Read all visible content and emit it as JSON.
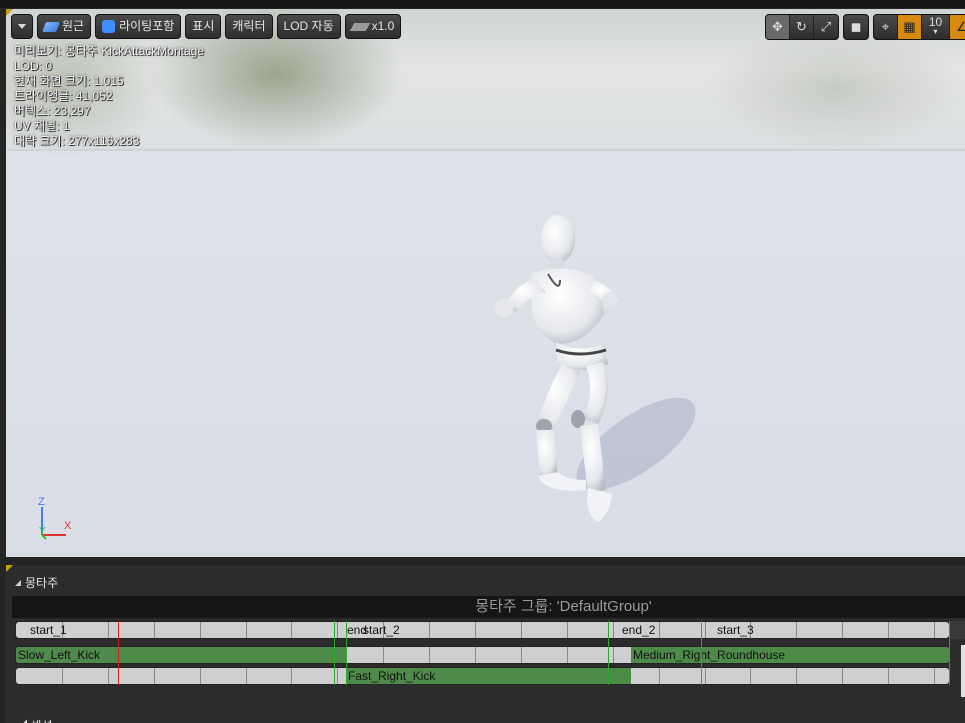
{
  "toolbar": {
    "menu_icon": "chevron-down-icon",
    "perspective_label": "원근",
    "lighting_label": "라이팅포함",
    "show_label": "표시",
    "character_label": "캐릭터",
    "lod_label": "LOD 자동",
    "speed_label": "x1.0"
  },
  "viewport_tools": {
    "grid_snap_value": "10"
  },
  "stats": [
    "미리보기: 몽타주 KickAttackMontage",
    "LOD: 0",
    "현재 화면 크기: 1.015",
    "트라이앵글: 41,052",
    "버텍스: 23,297",
    "UV 채널: 1",
    "대략 크기: 277x116x283"
  ],
  "axis": {
    "z": "Z",
    "x": "X",
    "y": "Y"
  },
  "montage_panel": {
    "title": "몽타주",
    "group_header": "몽타주 그룹: 'DefaultGroup'",
    "section_labels": [
      "start_1",
      "end",
      "start_2",
      "end_2",
      "start_3"
    ],
    "slot_segments_row1": [
      "Slow_Left_Kick",
      "Medium_Right_Roundhouse"
    ],
    "slot_segments_row2": [
      "Fast_Right_Kick"
    ],
    "next_panel_title": "섹션"
  },
  "colors": {
    "segment_green": "#4e8b4a",
    "marker_green": "#2ca82c",
    "playhead_red": "#d52020",
    "snap_orange": "#d68a10"
  }
}
